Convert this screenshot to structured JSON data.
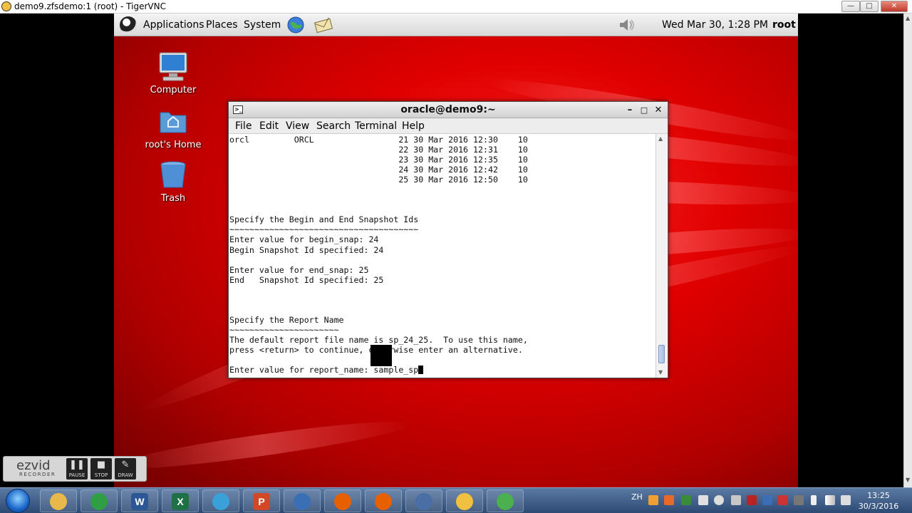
{
  "vnc_window": {
    "title": "demo9.zfsdemo:1 (root) - TigerVNC"
  },
  "panel": {
    "menus": [
      "Applications",
      "Places",
      "System"
    ],
    "datetime": "Wed Mar 30,  1:28 PM",
    "user": "root"
  },
  "desktop_icons": [
    {
      "label": "Computer",
      "icon": "computer-icon"
    },
    {
      "label": "root's Home",
      "icon": "home-folder-icon"
    },
    {
      "label": "Trash",
      "icon": "trash-icon"
    }
  ],
  "terminal": {
    "title": "oracle@demo9:~",
    "menu": [
      "File",
      "Edit",
      "View",
      "Search",
      "Terminal",
      "Help"
    ],
    "lines": [
      "orcl         ORCL                 21 30 Mar 2016 12:30    10",
      "                                  22 30 Mar 2016 12:31    10",
      "                                  23 30 Mar 2016 12:35    10",
      "                                  24 30 Mar 2016 12:42    10",
      "                                  25 30 Mar 2016 12:50    10",
      "",
      "",
      "",
      "Specify the Begin and End Snapshot Ids",
      "~~~~~~~~~~~~~~~~~~~~~~~~~~~~~~~~~~~~~~",
      "Enter value for begin_snap: 24",
      "Begin Snapshot Id specified: 24",
      "",
      "Enter value for end_snap: 25",
      "End   Snapshot Id specified: 25",
      "",
      "",
      "",
      "Specify the Report Name",
      "~~~~~~~~~~~~~~~~~~~~~~",
      "The default report file name is sp_24_25.  To use this name,",
      "press <return> to continue, otherwise enter an alternative.",
      "",
      "Enter value for report_name: sample_sp"
    ]
  },
  "ezvid": {
    "logo": "ezvid",
    "logo_sub": "RECORDER",
    "buttons": [
      "PAUSE",
      "STOP",
      "DRAW"
    ]
  },
  "taskbar": {
    "apps": [
      {
        "name": "file-explorer-icon",
        "color": "#e8b84a"
      },
      {
        "name": "chrome-icon",
        "color": "#2f9e44"
      },
      {
        "name": "word-icon",
        "color": "#2b5797",
        "glyph": "W"
      },
      {
        "name": "excel-icon",
        "color": "#1e7145",
        "glyph": "X"
      },
      {
        "name": "globe-icon",
        "color": "#3aa0d8"
      },
      {
        "name": "powerpoint-icon",
        "color": "#d24726",
        "glyph": "P"
      },
      {
        "name": "thunderbird-icon",
        "color": "#3a6fb5"
      },
      {
        "name": "firefox-icon",
        "color": "#e66000"
      },
      {
        "name": "firefox-icon",
        "color": "#e66000"
      },
      {
        "name": "network-icon",
        "color": "#4a6fa5"
      },
      {
        "name": "tigervnc-icon",
        "color": "#f0c040"
      },
      {
        "name": "green-globe-icon",
        "color": "#4caf50"
      }
    ],
    "tray_lang": "ZH",
    "clock_time": "13:25",
    "clock_date": "30/3/2016"
  },
  "colors": {
    "desktop_red": "#e00000",
    "taskbar": "#2c4a73"
  }
}
